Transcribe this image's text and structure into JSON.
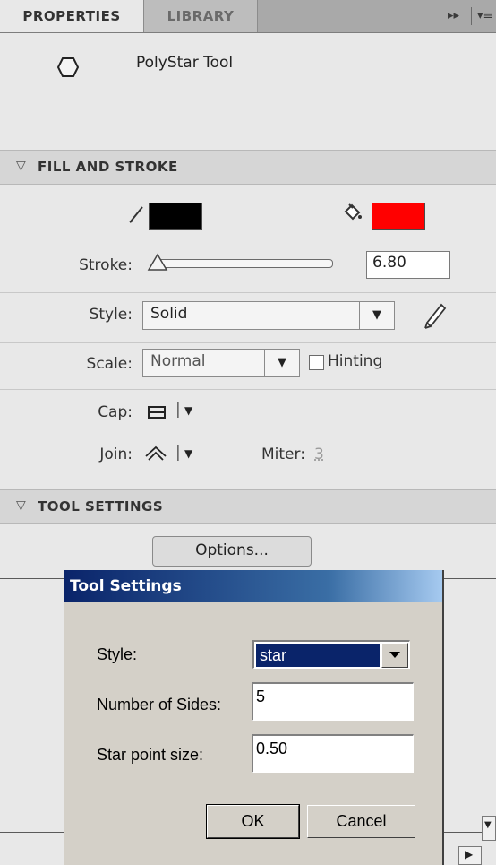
{
  "tabs": [
    {
      "label": "PROPERTIES",
      "active": true
    },
    {
      "label": "LIBRARY",
      "active": false
    }
  ],
  "tab_controls": {
    "collapse": "▸▸",
    "menu": "▾≡"
  },
  "tool": {
    "name": "PolyStar Tool",
    "icon": "hexagon-icon"
  },
  "fill_and_stroke": {
    "header": "FILL AND STROKE",
    "stroke_color": "#000000",
    "fill_color": "#ff0000",
    "stroke_label": "Stroke:",
    "stroke_value": "6.80",
    "style_label": "Style:",
    "style_value": "Solid",
    "scale_label": "Scale:",
    "scale_value": "Normal",
    "hinting_label": "Hinting",
    "hinting_checked": false,
    "cap_label": "Cap:",
    "join_label": "Join:",
    "miter_label": "Miter:",
    "miter_value": "3"
  },
  "tool_settings": {
    "header": "TOOL SETTINGS",
    "options_button": "Options..."
  },
  "dialog": {
    "title": "Tool Settings",
    "style_label": "Style:",
    "style_value": "star",
    "sides_label": "Number of Sides:",
    "sides_value": "5",
    "point_label": "Star point size:",
    "point_value": "0.50",
    "ok_label": "OK",
    "cancel_label": "Cancel"
  }
}
